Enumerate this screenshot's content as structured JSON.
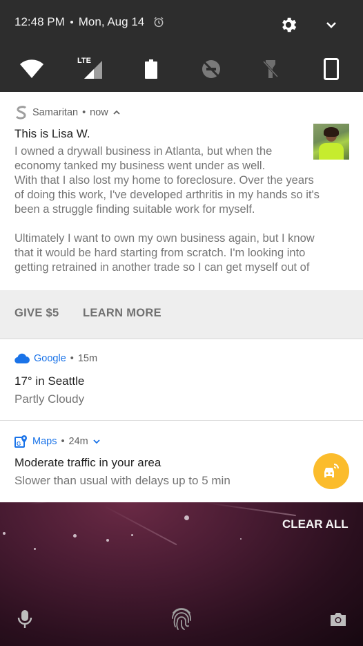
{
  "status": {
    "time": "12:48 PM",
    "date": "Mon, Aug 14",
    "icons": [
      "alarm-icon",
      "gear-icon",
      "chevron-down-icon"
    ]
  },
  "quick_tiles": [
    {
      "name": "wifi-icon"
    },
    {
      "name": "lte-signal-icon",
      "label": "LTE"
    },
    {
      "name": "battery-icon"
    },
    {
      "name": "do-not-disturb-off-icon"
    },
    {
      "name": "flashlight-off-icon"
    },
    {
      "name": "auto-rotate-icon"
    }
  ],
  "notifications": {
    "samaritan": {
      "app": "Samaritan",
      "time": "now",
      "title": "This is Lisa W.",
      "body_lines": [
        "I owned a drywall business in Atlanta, but when the",
        "economy tanked my business went under as well.",
        "With that I also lost my home to foreclosure. Over the years",
        "of doing this work, I've developed arthritis in my hands so it's",
        "been a struggle finding suitable work for myself.",
        "Ultimately I want to own my own business again, but I know",
        "that it would be hard starting from scratch. I'm looking into",
        "getting retrained in another trade so I can get myself out of"
      ],
      "actions": [
        "GIVE $5",
        "LEARN MORE"
      ]
    },
    "google": {
      "app": "Google",
      "time": "15m",
      "title": "17° in Seattle",
      "subtitle": "Partly Cloudy"
    },
    "maps": {
      "app": "Maps",
      "time": "24m",
      "title": "Moderate traffic in your area",
      "subtitle": "Slower than usual with delays up to 5 min"
    }
  },
  "clear_all": "CLEAR ALL",
  "bottom_icons": [
    "microphone-icon",
    "fingerprint-icon",
    "camera-icon"
  ],
  "colors": {
    "quick_settings_bg": "#2d2d2d",
    "accent_blue": "#1a73e8",
    "traffic_yellow": "#fbbc2c",
    "actions_bg": "#eeeeee"
  }
}
